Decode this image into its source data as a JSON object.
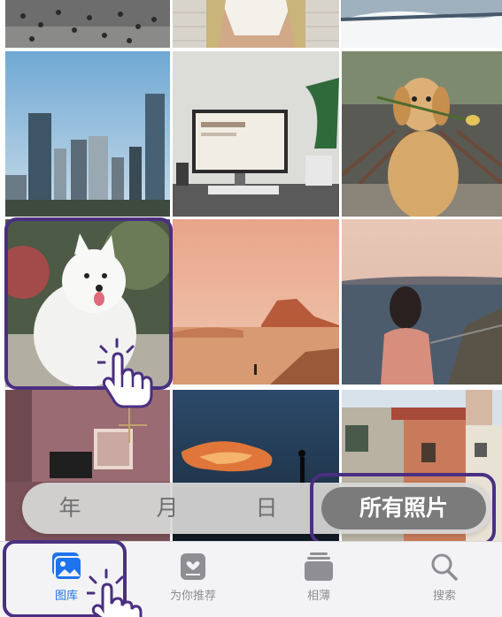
{
  "timeline": {
    "year": "年",
    "month": "月",
    "day": "日",
    "all_photos": "所有照片"
  },
  "tabs": [
    {
      "label": "图库",
      "icon": "photos-library-icon",
      "active": true
    },
    {
      "label": "为你推荐",
      "icon": "for-you-icon",
      "active": false
    },
    {
      "label": "相薄",
      "icon": "albums-icon",
      "active": false
    },
    {
      "label": "搜索",
      "icon": "search-icon",
      "active": false
    }
  ],
  "colors": {
    "accent": "#1e74ec",
    "highlight_frame": "#4a2f82",
    "tab_inactive": "#8e8e93"
  },
  "photos": [
    "crowd",
    "person-torso",
    "snow",
    "city-skyline",
    "desk-monitor",
    "golden-retriever-flower",
    "samoyed-dog",
    "desert-rocks",
    "girl-by-sea",
    "pink-room",
    "sunset-clouds",
    "old-buildings"
  ]
}
